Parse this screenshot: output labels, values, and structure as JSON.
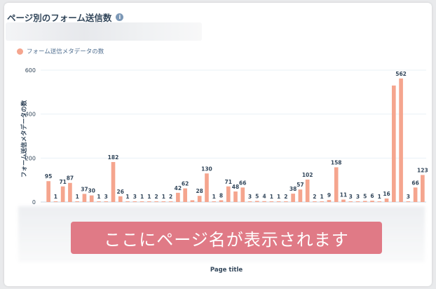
{
  "card": {
    "title": "ページ別のフォーム送信数",
    "info_icon": "info-icon"
  },
  "legend": {
    "label": "フォーム送信メタデータの数",
    "color": "#f5a58e"
  },
  "banner": {
    "text": "ここにページ名が表示されます",
    "color": "#e07a86"
  },
  "chart_data": {
    "type": "bar",
    "xlabel": "Page title",
    "ylabel": "フォーム送信メタデータの数",
    "ylim": [
      0,
      600
    ],
    "yticks": [
      0,
      200,
      400,
      600
    ],
    "grid": true,
    "bar_color": "#f5a58e",
    "series": [
      {
        "name": "フォーム送信メタデータの数",
        "values": [
          95,
          1,
          71,
          87,
          1,
          37,
          30,
          1,
          3,
          182,
          26,
          1,
          3,
          1,
          1,
          2,
          1,
          2,
          42,
          62,
          8,
          28,
          130,
          1,
          8,
          71,
          48,
          66,
          3,
          5,
          4,
          1,
          1,
          2,
          38,
          57,
          102,
          2,
          1,
          9,
          158,
          11,
          3,
          3,
          5,
          6,
          1,
          16,
          530,
          562,
          3,
          66,
          123
        ],
        "labels": [
          "95",
          "1",
          "71",
          "87",
          "1",
          "37",
          "30",
          "1",
          "3",
          "182",
          "26",
          "1",
          "3",
          "1",
          "1",
          "2",
          "1",
          "2",
          "42",
          "62",
          "",
          "28",
          "130",
          "1",
          "8",
          "71",
          "48",
          "66",
          "3",
          "5",
          "4",
          "1",
          "1",
          "2",
          "38",
          "57",
          "102",
          "2",
          "1",
          "9",
          "158",
          "11",
          "3",
          "3",
          "5",
          "6",
          "1",
          "16",
          "",
          "562",
          "3",
          "66",
          "123"
        ]
      }
    ]
  }
}
